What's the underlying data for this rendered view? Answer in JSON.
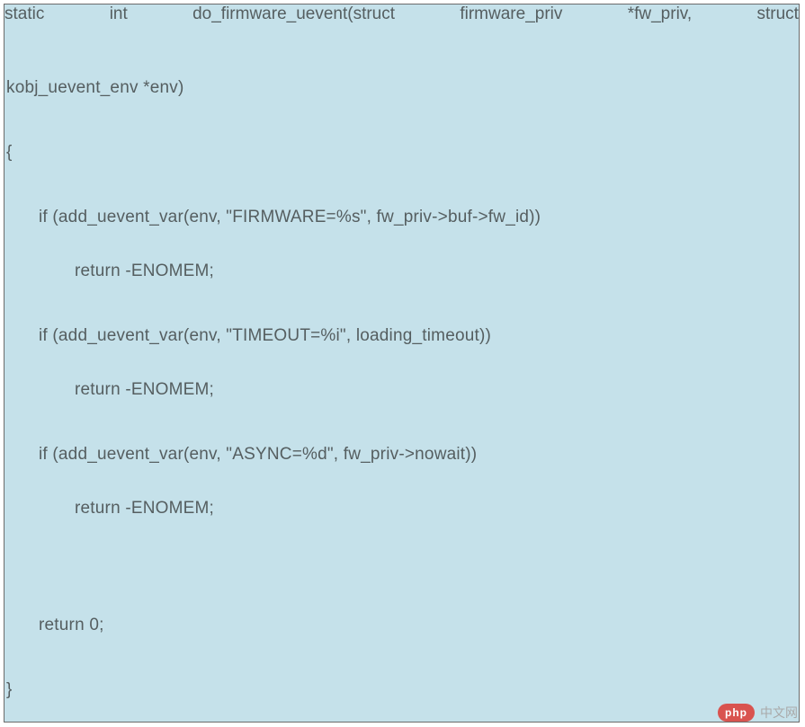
{
  "code": {
    "sig_tokens": [
      "static",
      "int",
      "do_firmware_uevent(struct",
      "firmware_priv",
      "*fw_priv,",
      "struct"
    ],
    "sig_cont": "kobj_uevent_env *env)",
    "brace_open": "{",
    "if1": "if (add_uevent_var(env, \"FIRMWARE=%s\", fw_priv->buf->fw_id))",
    "ret1": "return -ENOMEM;",
    "if2": "if (add_uevent_var(env, \"TIMEOUT=%i\", loading_timeout))",
    "ret2": "return -ENOMEM;",
    "if3": "if (add_uevent_var(env, \"ASYNC=%d\", fw_priv->nowait))",
    "ret3": "return -ENOMEM;",
    "ret0": "return 0;",
    "brace_close": "}"
  },
  "watermark": {
    "brand_pill": "php",
    "brand_text": "中文网"
  }
}
